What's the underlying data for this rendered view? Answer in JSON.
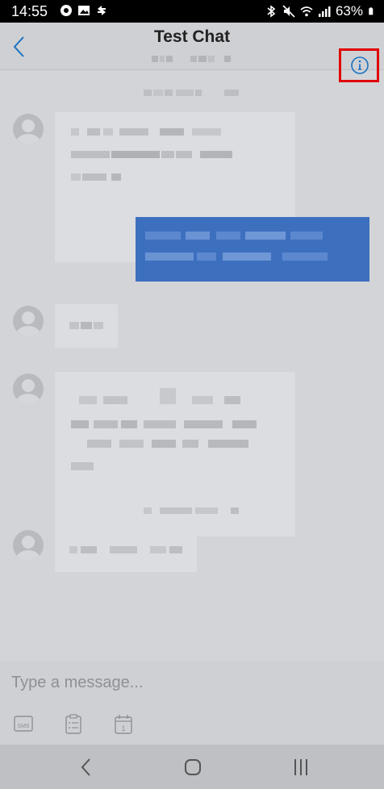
{
  "status_bar": {
    "time": "14:55",
    "battery": "63%",
    "icons": [
      "location-icon",
      "image-icon",
      "sync-icon",
      "bluetooth-icon",
      "mute-icon",
      "wifi-icon",
      "signal-icon",
      "battery-icon"
    ]
  },
  "header": {
    "title": "Test Chat",
    "back_icon": "chevron-left-icon",
    "info_icon": "info-icon"
  },
  "composer": {
    "placeholder": "Type a message...",
    "tools": [
      "sms-icon",
      "template-icon",
      "calendar-icon"
    ],
    "calendar_day": "1",
    "sms_label": "SMS"
  },
  "nav": {
    "buttons": [
      "back-nav-icon",
      "home-nav-icon",
      "recents-nav-icon"
    ]
  },
  "colors": {
    "accent": "#1a73c2",
    "outgoing_bubble": "#3d6fbf",
    "highlight": "#e00000"
  }
}
